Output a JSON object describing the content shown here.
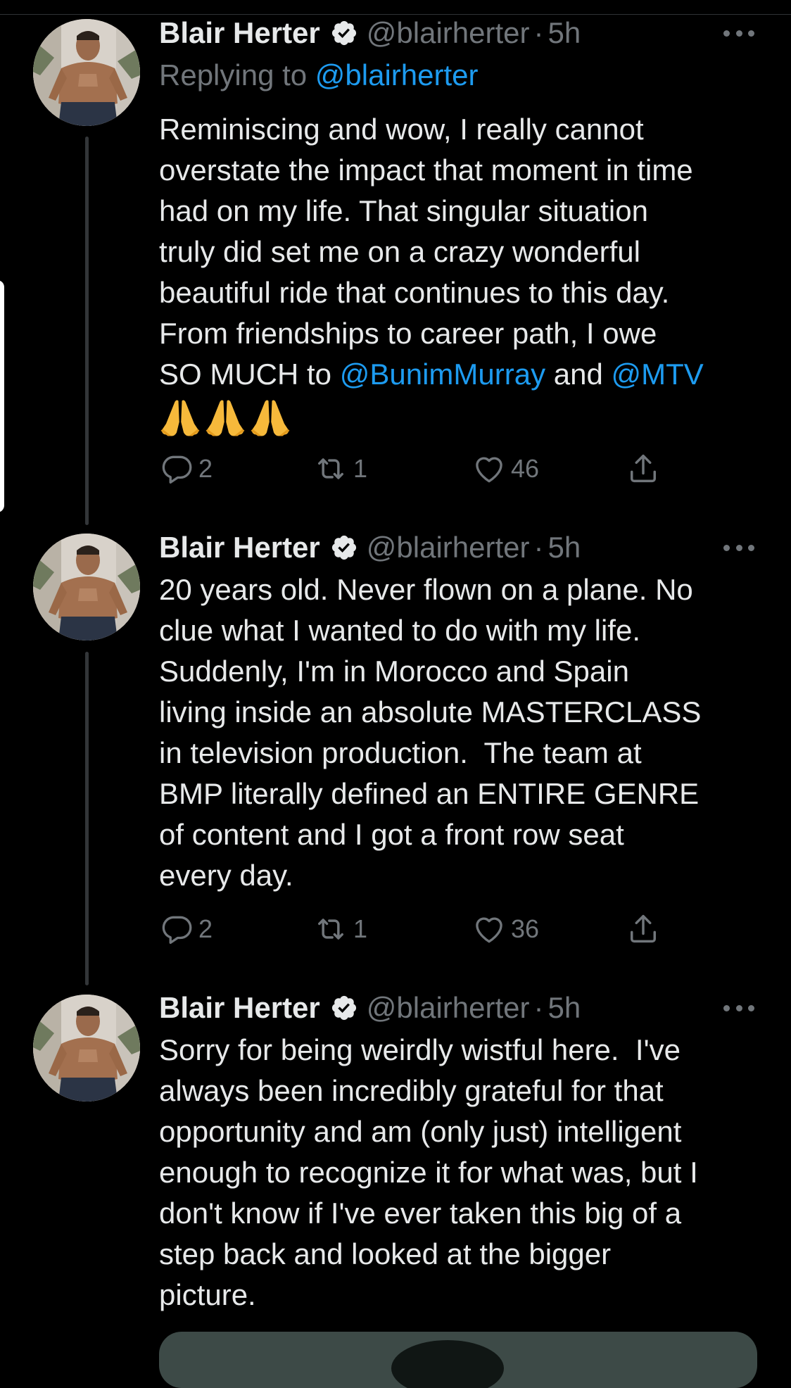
{
  "colors": {
    "background": "#000000",
    "text": "#e7e9ea",
    "muted": "#71767b",
    "link": "#1d9bf0",
    "thread_line": "#333639",
    "verified_badge": "#e7e9ea"
  },
  "tweets": [
    {
      "author": {
        "name": "Blair Herter",
        "handle": "@blairherter",
        "verified_icon": "verified-badge-icon",
        "avatar_icon": "avatar-photo"
      },
      "separator": "·",
      "time": "5h",
      "more_icon": "more-dots-icon",
      "reply_prefix": "Replying to ",
      "reply_handle": "@blairherter",
      "lines": [
        "Reminiscing and wow, I really cannot",
        "overstate the impact that moment in time",
        "had on my life. That singular situation",
        "truly did set me on a crazy wonderful",
        "beautiful ride that continues to this day.",
        "From friendships to career path, I owe"
      ],
      "last_line": {
        "before": "SO MUCH to ",
        "mention1": "@BunimMurray",
        "middle": " and ",
        "mention2": "@MTV"
      },
      "emoji": [
        "🙏",
        "🙏",
        "🙏"
      ],
      "actions": {
        "replies": "2",
        "retweets": "1",
        "likes": "46"
      }
    },
    {
      "author": {
        "name": "Blair Herter",
        "handle": "@blairherter",
        "verified_icon": "verified-badge-icon",
        "avatar_icon": "avatar-photo"
      },
      "separator": "·",
      "time": "5h",
      "more_icon": "more-dots-icon",
      "lines": [
        "20 years old. Never flown on a plane. No",
        "clue what I wanted to do with my life.",
        "Suddenly, I'm in Morocco and Spain",
        "living inside an absolute MASTERCLASS",
        "in television production.  The team at",
        "BMP literally defined an ENTIRE GENRE",
        "of content and I got a front row seat",
        "every day."
      ],
      "actions": {
        "replies": "2",
        "retweets": "1",
        "likes": "36"
      }
    },
    {
      "author": {
        "name": "Blair Herter",
        "handle": "@blairherter",
        "verified_icon": "verified-badge-icon",
        "avatar_icon": "avatar-photo"
      },
      "separator": "·",
      "time": "5h",
      "more_icon": "more-dots-icon",
      "lines": [
        "Sorry for being weirdly wistful here.  I've",
        "always been incredibly grateful for that",
        "opportunity and am (only just) intelligent",
        "enough to recognize it for what was, but I",
        "don't know if I've ever taken this big of a",
        "step back and looked at the bigger",
        "picture."
      ]
    }
  ],
  "action_icons": {
    "reply": "reply-bubble-icon",
    "retweet": "retweet-icon",
    "like": "heart-icon",
    "share": "share-icon"
  }
}
